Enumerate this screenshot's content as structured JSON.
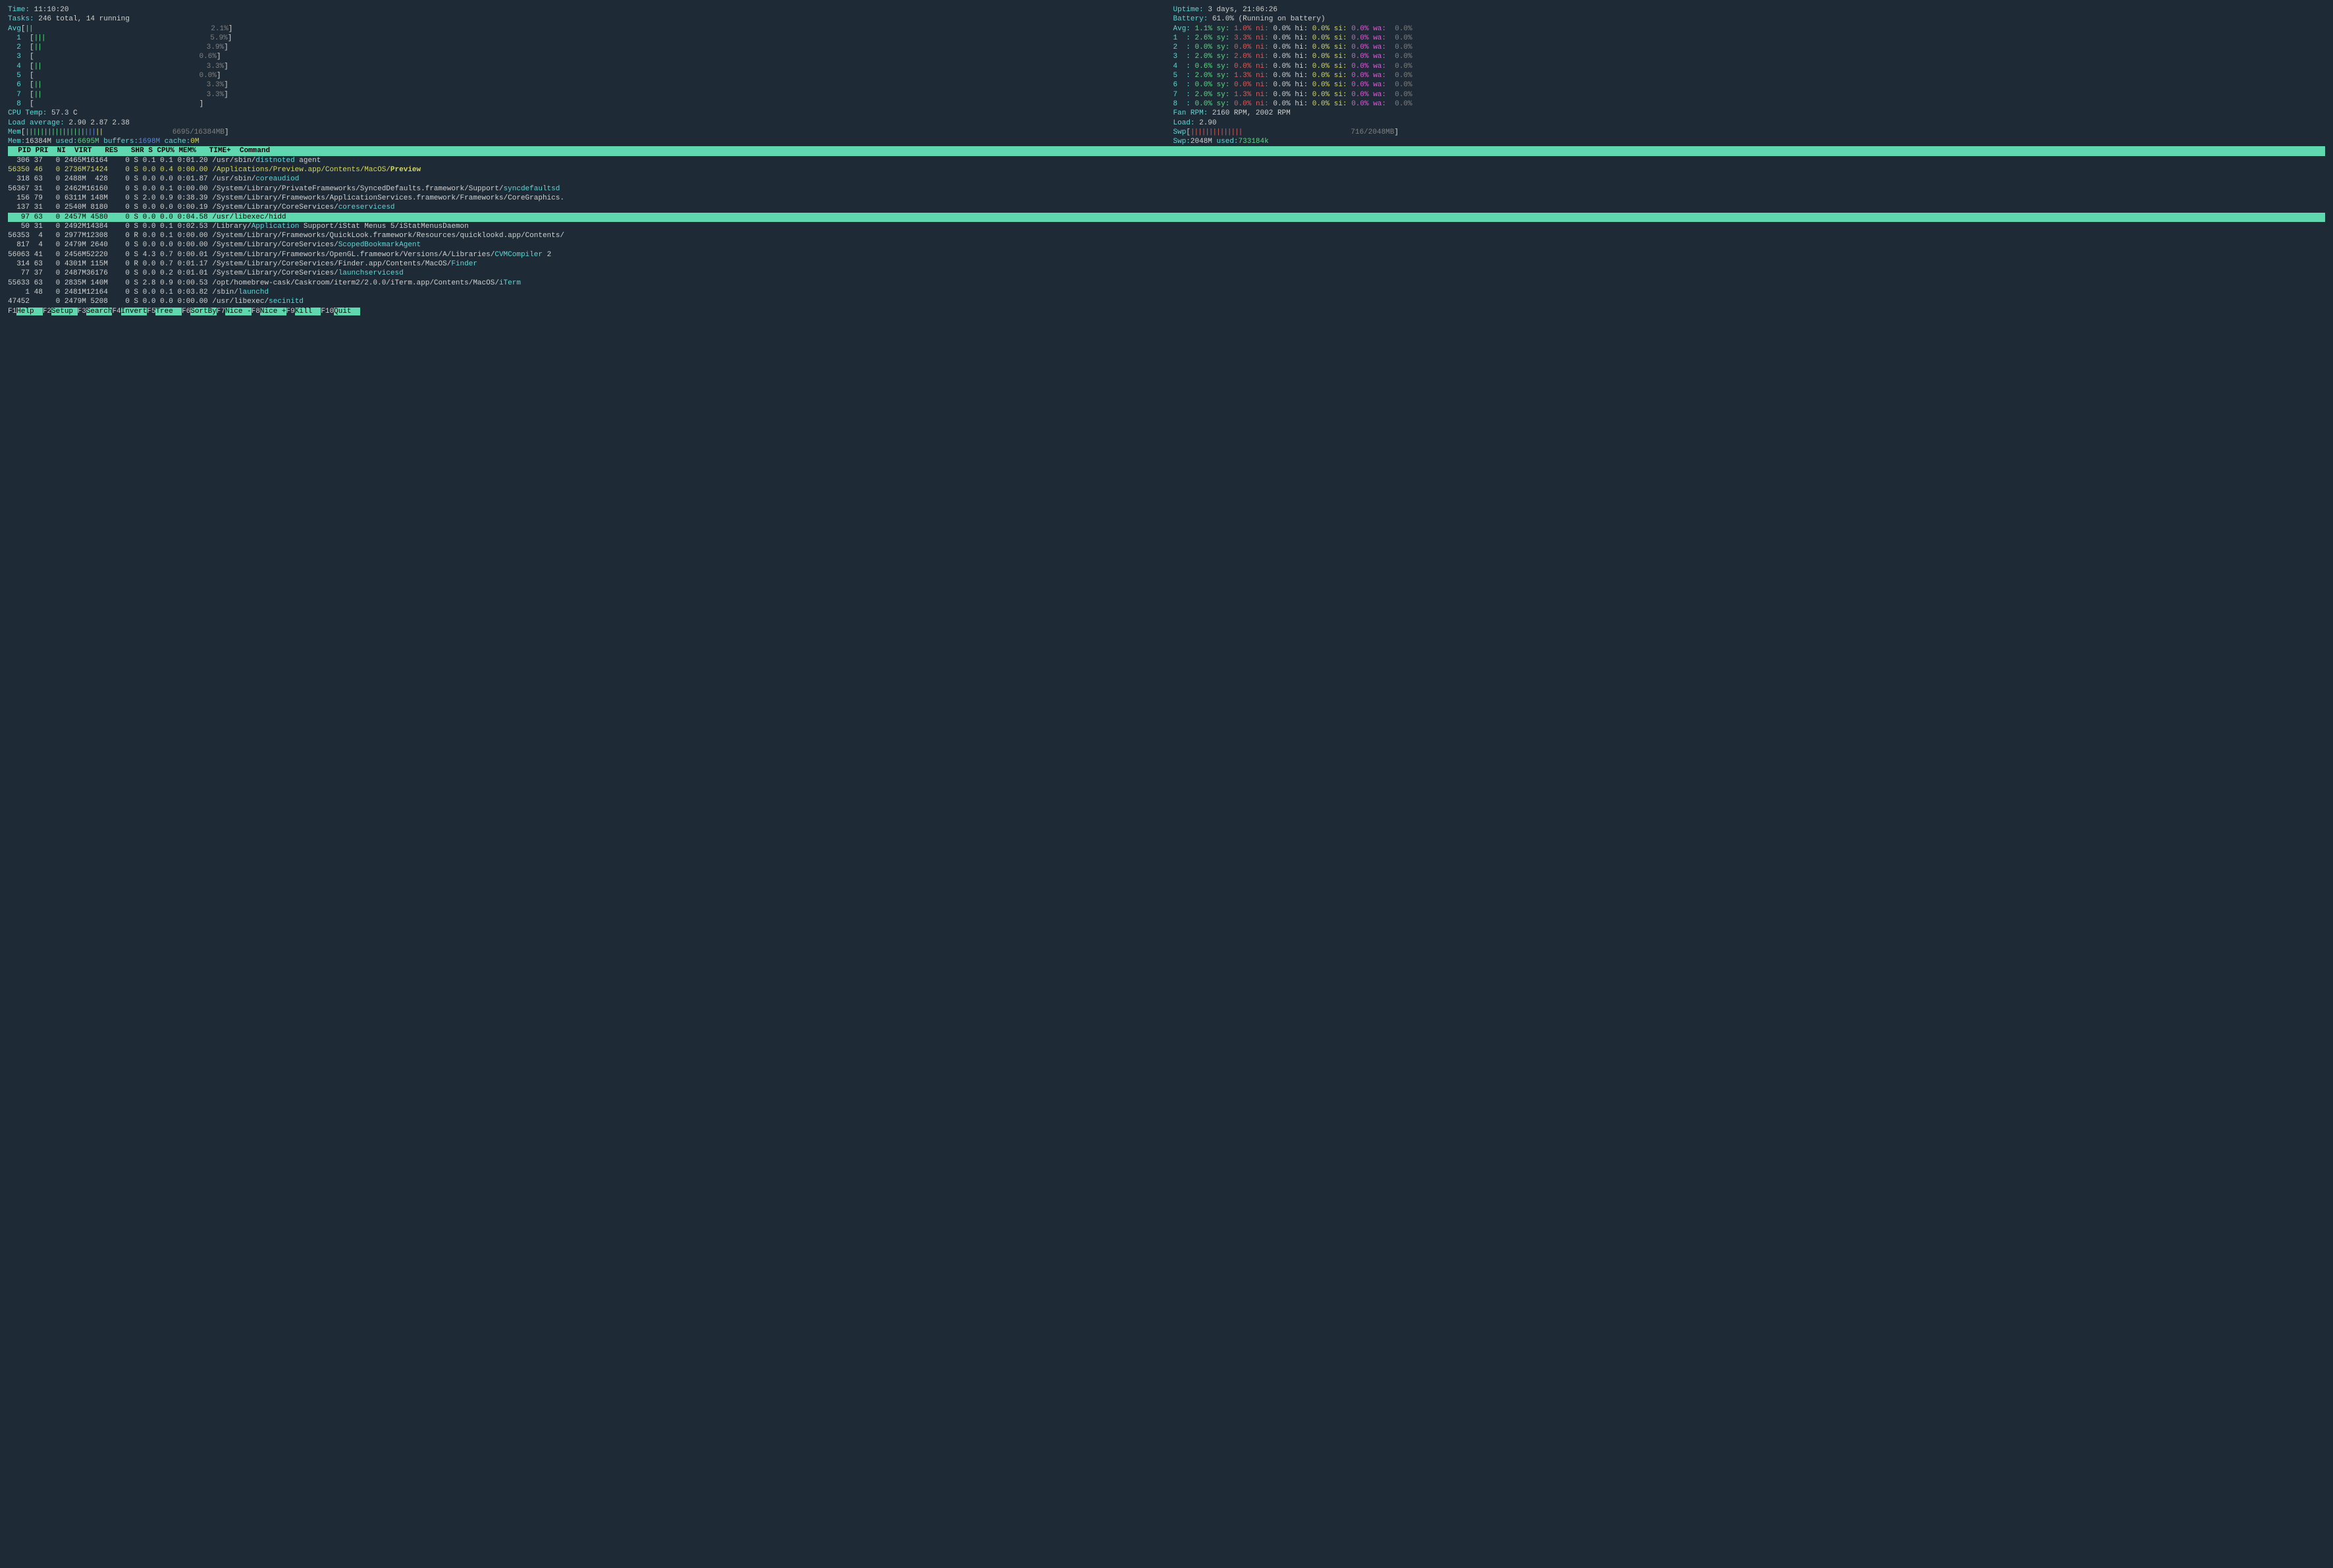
{
  "top_left": {
    "time_label": "Time: ",
    "time_value": "11:10:20",
    "tasks_label": "Tasks: ",
    "tasks_value": "246 total, 14 running",
    "avg_label": "Avg",
    "cores": [
      "1",
      "2",
      "3",
      "4",
      "5",
      "6",
      "7",
      "8"
    ],
    "core_pct": [
      "2.1%",
      "5.9%",
      "3.9%",
      "0.6%",
      "3.3%",
      "0.0%",
      "3.3%",
      ""
    ],
    "cpu_temp_label": "CPU Temp: ",
    "cpu_temp_value": "57.3 C",
    "load_avg_label": "Load average: ",
    "load_avg_value": "2.90 2.87 2.38",
    "mem_label": "Mem",
    "mem_value": "6695/16384MB",
    "mem_detail": "Mem:16384M used:6695M buffers:1698M cache:0M"
  },
  "top_right": {
    "uptime_label": "Uptime: ",
    "uptime_value": "3 days, 21:06:26",
    "battery_label": "Battery: ",
    "battery_value": "61.0% (Running on battery)",
    "cpu_rows": [
      {
        "lbl": "Avg:",
        "sy": "1.1% sy:",
        "ni": "1.0% ni:",
        "hi": "0.0% hi:",
        "si": "0.0% si:",
        "wa": "0.0% wa:",
        "end": "0.0%"
      },
      {
        "lbl": "1  :",
        "sy": "2.6% sy:",
        "ni": "3.3% ni:",
        "hi": "0.0% hi:",
        "si": "0.0% si:",
        "wa": "0.0% wa:",
        "end": "0.0%"
      },
      {
        "lbl": "2  :",
        "sy": "0.0% sy:",
        "ni": "0.0% ni:",
        "hi": "0.0% hi:",
        "si": "0.0% si:",
        "wa": "0.0% wa:",
        "end": "0.0%"
      },
      {
        "lbl": "3  :",
        "sy": "2.0% sy:",
        "ni": "2.0% ni:",
        "hi": "0.0% hi:",
        "si": "0.0% si:",
        "wa": "0.0% wa:",
        "end": "0.0%"
      },
      {
        "lbl": "4  :",
        "sy": "0.6% sy:",
        "ni": "0.0% ni:",
        "hi": "0.0% hi:",
        "si": "0.0% si:",
        "wa": "0.0% wa:",
        "end": "0.0%"
      },
      {
        "lbl": "5  :",
        "sy": "2.0% sy:",
        "ni": "1.3% ni:",
        "hi": "0.0% hi:",
        "si": "0.0% si:",
        "wa": "0.0% wa:",
        "end": "0.0%"
      },
      {
        "lbl": "6  :",
        "sy": "0.0% sy:",
        "ni": "0.0% ni:",
        "hi": "0.0% hi:",
        "si": "0.0% si:",
        "wa": "0.0% wa:",
        "end": "0.0%"
      },
      {
        "lbl": "7  :",
        "sy": "2.0% sy:",
        "ni": "1.3% ni:",
        "hi": "0.0% hi:",
        "si": "0.0% si:",
        "wa": "0.0% wa:",
        "end": "0.0%"
      },
      {
        "lbl": "8  :",
        "sy": "0.0% sy:",
        "ni": "0.0% ni:",
        "hi": "0.0% hi:",
        "si": "0.0% si:",
        "wa": "0.0% wa:",
        "end": "0.0%"
      }
    ],
    "fan_label": "Fan RPM: ",
    "fan_value": "2160 RPM, 2002 RPM",
    "load_label": "Load: ",
    "load_value": "2.90",
    "swp_label": "Swp",
    "swp_value": "716/2048MB",
    "swp_detail": "Swp:2048M used:733184k"
  },
  "columns": "  PID PRI  NI  VIRT   RES   SHR S CPU% MEM%   TIME+  Command",
  "processes": [
    {
      "pid": "  306",
      " pri": " 37",
      "ni": "   0",
      "virt": " 2465M",
      "res": "16164",
      "shr": "    0",
      "s": "S",
      "cpu": " 0.1",
      "mem": " 0.1",
      "time": " 0:01.20",
      "cmd": "/usr/sbin/",
      "hl": "distnoted",
      "tail": " agent"
    },
    {
      "pid": "56350",
      " pri": " 46",
      "ni": "   0",
      "virt": " 2736M",
      "res": "71424",
      "shr": "    0",
      "s": "S",
      "cpu": " 0.0",
      "mem": " 0.4",
      "time": " 0:00.00",
      "cmd": "/Applications/Preview.app/Contents/MacOS/",
      "hl": "Preview",
      "tail": "",
      "sel_yellow": true
    },
    {
      "pid": "  318",
      " pri": " 63",
      "ni": "   0",
      "virt": " 2488M",
      "res": "  428",
      "shr": "    0",
      "s": "S",
      "cpu": " 0.0",
      "mem": " 0.0",
      "time": " 0:01.87",
      "cmd": "/usr/sbin/",
      "hl": "coreaudiod",
      "tail": ""
    },
    {
      "pid": "56367",
      " pri": " 31",
      "ni": "   0",
      "virt": " 2462M",
      "res": "16160",
      "shr": "    0",
      "s": "S",
      "cpu": " 0.0",
      "mem": " 0.1",
      "time": " 0:00.00",
      "cmd": "/System/Library/PrivateFrameworks/SyncedDefaults.framework/Support/",
      "hl": "syncdefaultsd",
      "tail": ""
    },
    {
      "pid": "  156",
      " pri": " 79",
      "ni": "   0",
      "virt": " 6311M",
      "res": " 148M",
      "shr": "    0",
      "s": "S",
      "cpu": " 2.0",
      "mem": " 0.9",
      "time": " 0:38.39",
      "cmd": "/System/Library/Frameworks/ApplicationServices.framework/Frameworks/CoreGraphics.",
      "hl": "",
      "tail": ""
    },
    {
      "pid": "  137",
      " pri": " 31",
      "ni": "   0",
      "virt": " 2540M",
      "res": " 8180",
      "shr": "    0",
      "s": "S",
      "cpu": " 0.0",
      "mem": " 0.0",
      "time": " 0:00.19",
      "cmd": "/System/Library/CoreServices/",
      "hl": "coreservicesd",
      "tail": ""
    },
    {
      "pid": "   97",
      " pri": " 63",
      "ni": "   0",
      "virt": " 2457M",
      "res": " 4580",
      "shr": "    0",
      "s": "S",
      "cpu": " 0.0",
      "mem": " 0.0",
      "time": " 0:04.58",
      "cmd": "/usr/libexec/",
      "hl": "hidd",
      "tail": "",
      "selected": true
    },
    {
      "pid": "   50",
      " pri": " 31",
      "ni": "   0",
      "virt": " 2492M",
      "res": "14384",
      "shr": "    0",
      "s": "S",
      "cpu": " 0.0",
      "mem": " 0.1",
      "time": " 0:02.53",
      "cmd": "/Library/",
      "hl": "Application",
      "tail": " Support/iStat Menus 5/iStatMenusDaemon"
    },
    {
      "pid": "56353",
      " pri": "  4",
      "ni": "   0",
      "virt": " 2977M",
      "res": "12308",
      "shr": "    0",
      "s": "R",
      "cpu": " 0.0",
      "mem": " 0.1",
      "time": " 0:00.00",
      "cmd": "/System/Library/Frameworks/QuickLook.framework/Resources/quicklookd.app/Contents/",
      "hl": "",
      "tail": ""
    },
    {
      "pid": "  817",
      " pri": "  4",
      "ni": "   0",
      "virt": " 2479M",
      "res": " 2640",
      "shr": "    0",
      "s": "S",
      "cpu": " 0.0",
      "mem": " 0.0",
      "time": " 0:00.00",
      "cmd": "/System/Library/CoreServices/",
      "hl": "ScopedBookmarkAgent",
      "tail": ""
    },
    {
      "pid": "56063",
      " pri": " 41",
      "ni": "   0",
      "virt": " 2456M",
      "res": "52220",
      "shr": "    0",
      "s": "S",
      "cpu": " 4.3",
      "mem": " 0.7",
      "time": " 0:00.01",
      "cmd": "/System/Library/Frameworks/OpenGL.framework/Versions/A/Libraries/",
      "hl": "CVMCompiler",
      "tail": " 2"
    },
    {
      "pid": "  314",
      " pri": " 63",
      "ni": "   0",
      "virt": " 4301M",
      "res": " 115M",
      "shr": "    0",
      "s": "R",
      "cpu": " 0.0",
      "mem": " 0.7",
      "time": " 0:01.17",
      "cmd": "/System/Library/CoreServices/Finder.app/Contents/MacOS/",
      "hl": "Finder",
      "tail": ""
    },
    {
      "pid": "   77",
      " pri": " 37",
      "ni": "   0",
      "virt": " 2487M",
      "res": "36176",
      "shr": "    0",
      "s": "S",
      "cpu": " 0.0",
      "mem": " 0.2",
      "time": " 0:01.01",
      "cmd": "/System/Library/CoreServices/",
      "hl": "launchservicesd",
      "tail": ""
    },
    {
      "pid": "55633",
      " pri": " 63",
      "ni": "   0",
      "virt": " 2835M",
      "res": " 140M",
      "shr": "    0",
      "s": "S",
      "cpu": " 2.8",
      "mem": " 0.9",
      "time": " 0:00.53",
      "cmd": "/opt/homebrew-cask/Caskroom/iterm2/2.0.0/iTerm.app/Contents/MacOS/",
      "hl": "iTerm",
      "tail": ""
    },
    {
      "pid": "    1",
      " pri": " 48",
      "ni": "   0",
      "virt": " 2481M",
      "res": "12164",
      "shr": "    0",
      "s": "S",
      "cpu": " 0.0",
      "mem": " 0.1",
      "time": " 0:03.82",
      "cmd": "/sbin/",
      "hl": "launchd",
      "tail": ""
    },
    {
      "pid": "47452",
      " pri": "   ",
      "ni": "   0",
      "virt": " 2479M",
      "res": " 5208",
      "shr": "    0",
      "s": "S",
      "cpu": " 0.0",
      "mem": " 0.0",
      "time": " 0:00.00",
      "cmd": "/usr/libexec/",
      "hl": "secinitd",
      "tail": ""
    }
  ],
  "footer": [
    {
      "k": "F1",
      "l": "Help  "
    },
    {
      "k": "F2",
      "l": "Setup "
    },
    {
      "k": "F3",
      "l": "Search"
    },
    {
      "k": "F4",
      "l": "Invert"
    },
    {
      "k": "F5",
      "l": "Tree  "
    },
    {
      "k": "F6",
      "l": "SortBy"
    },
    {
      "k": "F7",
      "l": "Nice -"
    },
    {
      "k": "F8",
      "l": "Nice +"
    },
    {
      "k": "F9",
      "l": "Kill  "
    },
    {
      "k": "F10",
      "l": "Quit  "
    }
  ]
}
